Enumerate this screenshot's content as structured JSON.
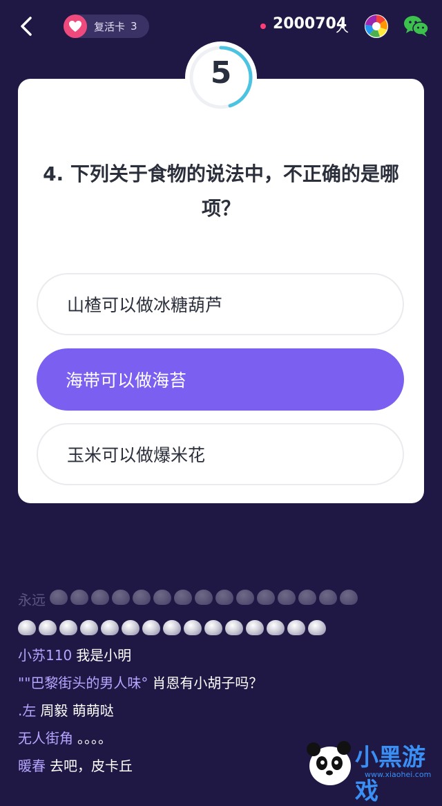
{
  "header": {
    "revive_card_label": "复活卡",
    "revive_card_count": "3",
    "online_count": "2000704",
    "online_unit": "人"
  },
  "timer": {
    "value": "5",
    "progress": 0.45
  },
  "question": {
    "text": "4. 下列关于食物的说法中，不正确的是哪项？"
  },
  "options": [
    {
      "label": "山楂可以做冰糖葫芦",
      "selected": false
    },
    {
      "label": "海带可以做海苔",
      "selected": true
    },
    {
      "label": "玉米可以做爆米花",
      "selected": false
    }
  ],
  "chat": [
    {
      "name": "永远",
      "message": ""
    },
    {
      "name": "小苏110",
      "message": "我是小明"
    },
    {
      "name": "\"\"巴黎街头的男人味°",
      "message": "肖恩有小胡子吗？"
    },
    {
      "name": ".左",
      "message": "周毅 萌萌哒"
    },
    {
      "name": "无人街角",
      "message": "。。。。"
    },
    {
      "name": "暖春",
      "message": "去吧，皮卡丘"
    }
  ],
  "watermark": {
    "text": "小黑游戏",
    "url": "www.xiaohei.com"
  },
  "colors": {
    "background": "#1f1845",
    "accent": "#7a5ff1",
    "timer_ring": "#4cc3e0",
    "heart": "#ee4a7d",
    "online_dot": "#ff3d77"
  },
  "icons": {
    "back": "chevron-left-icon",
    "revive": "heart-icon",
    "share1": "aperture-icon",
    "share2": "wechat-icon"
  }
}
